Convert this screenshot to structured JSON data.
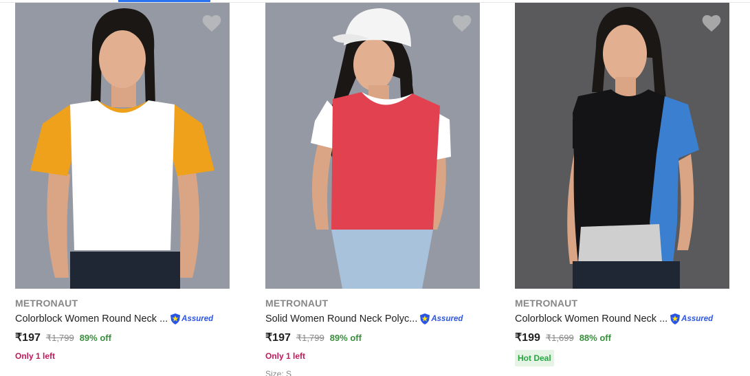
{
  "products": [
    {
      "brand": "METRONAUT",
      "title": "Colorblock Women Round Neck ...",
      "assured": "Assured",
      "price": "₹197",
      "mrp": "₹1,799",
      "discount": "89% off",
      "tag": "Only 1 left",
      "image_bg": "#8f949e",
      "shirt_main": "#ffffff",
      "shirt_accent": "#f0a11c"
    },
    {
      "brand": "METRONAUT",
      "title": "Solid Women Round Neck Polyc...",
      "assured": "Assured",
      "price": "₹197",
      "mrp": "₹1,799",
      "discount": "89% off",
      "tag": "Only 1 left",
      "peek": "Size: S",
      "image_bg": "#8f949e",
      "shirt_main": "#e2424f",
      "shirt_accent": "#ffffff"
    },
    {
      "brand": "METRONAUT",
      "title": "Colorblock Women Round Neck ...",
      "assured": "Assured",
      "price": "₹199",
      "mrp": "₹1,699",
      "discount": "88% off",
      "deal": "Hot Deal",
      "image_bg": "#5a5a5c",
      "shirt_main": "#141416",
      "shirt_accent": "#3a7fd0"
    }
  ],
  "colors": {
    "brand_text": "#878787",
    "discount": "#388e3c",
    "stock_warning": "#c2185b",
    "hot_deal_bg": "#e6f4e6",
    "hot_deal_text": "#26a541",
    "assured_blue": "#2a55e5",
    "accent": "#2874f0"
  },
  "icons": {
    "wishlist": "heart-icon",
    "assured": "assured-shield-icon"
  }
}
